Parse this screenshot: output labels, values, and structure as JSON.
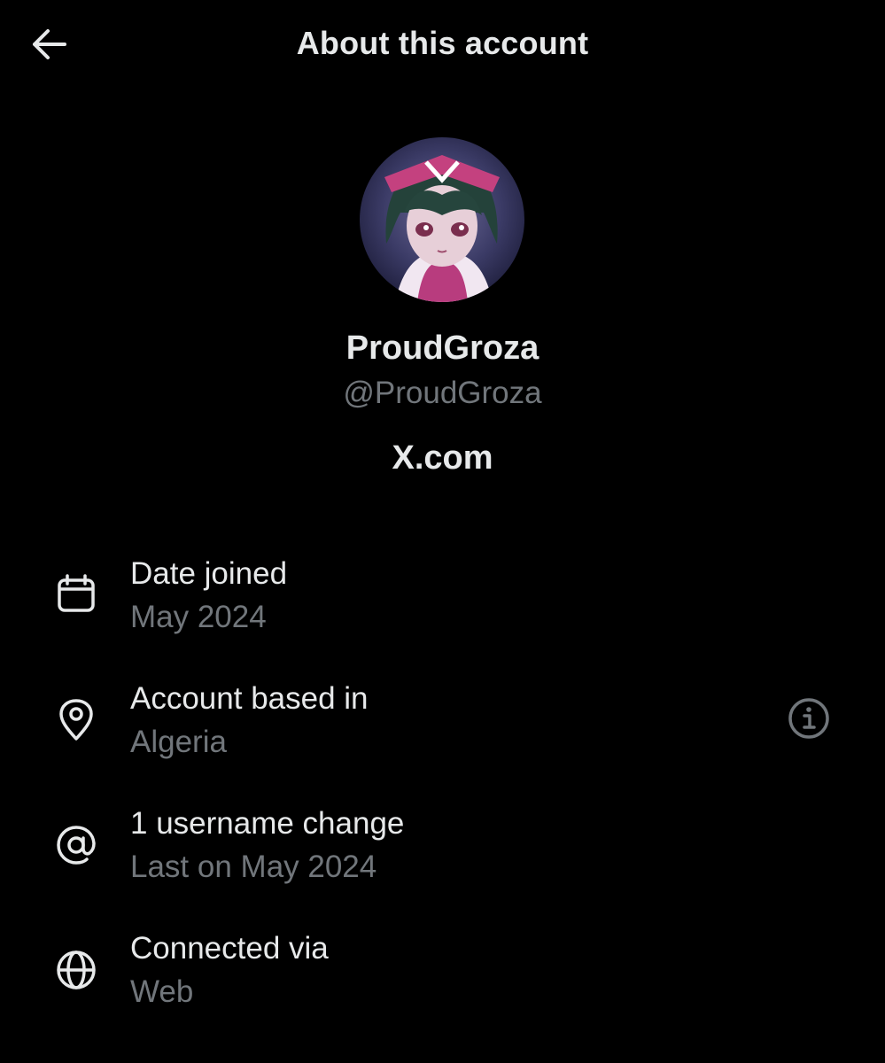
{
  "header": {
    "title": "About this account",
    "back_icon": "arrow-left-icon"
  },
  "profile": {
    "display_name": "ProudGroza",
    "handle": "@ProudGroza",
    "site": "X.com",
    "avatar_icon": "anime-character-avatar"
  },
  "details": [
    {
      "icon": "calendar-icon",
      "title": "Date joined",
      "value": "May 2024"
    },
    {
      "icon": "location-pin-icon",
      "title": "Account based in",
      "value": "Algeria",
      "trailing_icon": "info-icon"
    },
    {
      "icon": "at-sign-icon",
      "title": "1 username change",
      "value": "Last on May 2024"
    },
    {
      "icon": "globe-icon",
      "title": "Connected via",
      "value": "Web"
    }
  ],
  "colors": {
    "background": "#000000",
    "primary_text": "#e7e9ea",
    "secondary_text": "#71767b"
  }
}
